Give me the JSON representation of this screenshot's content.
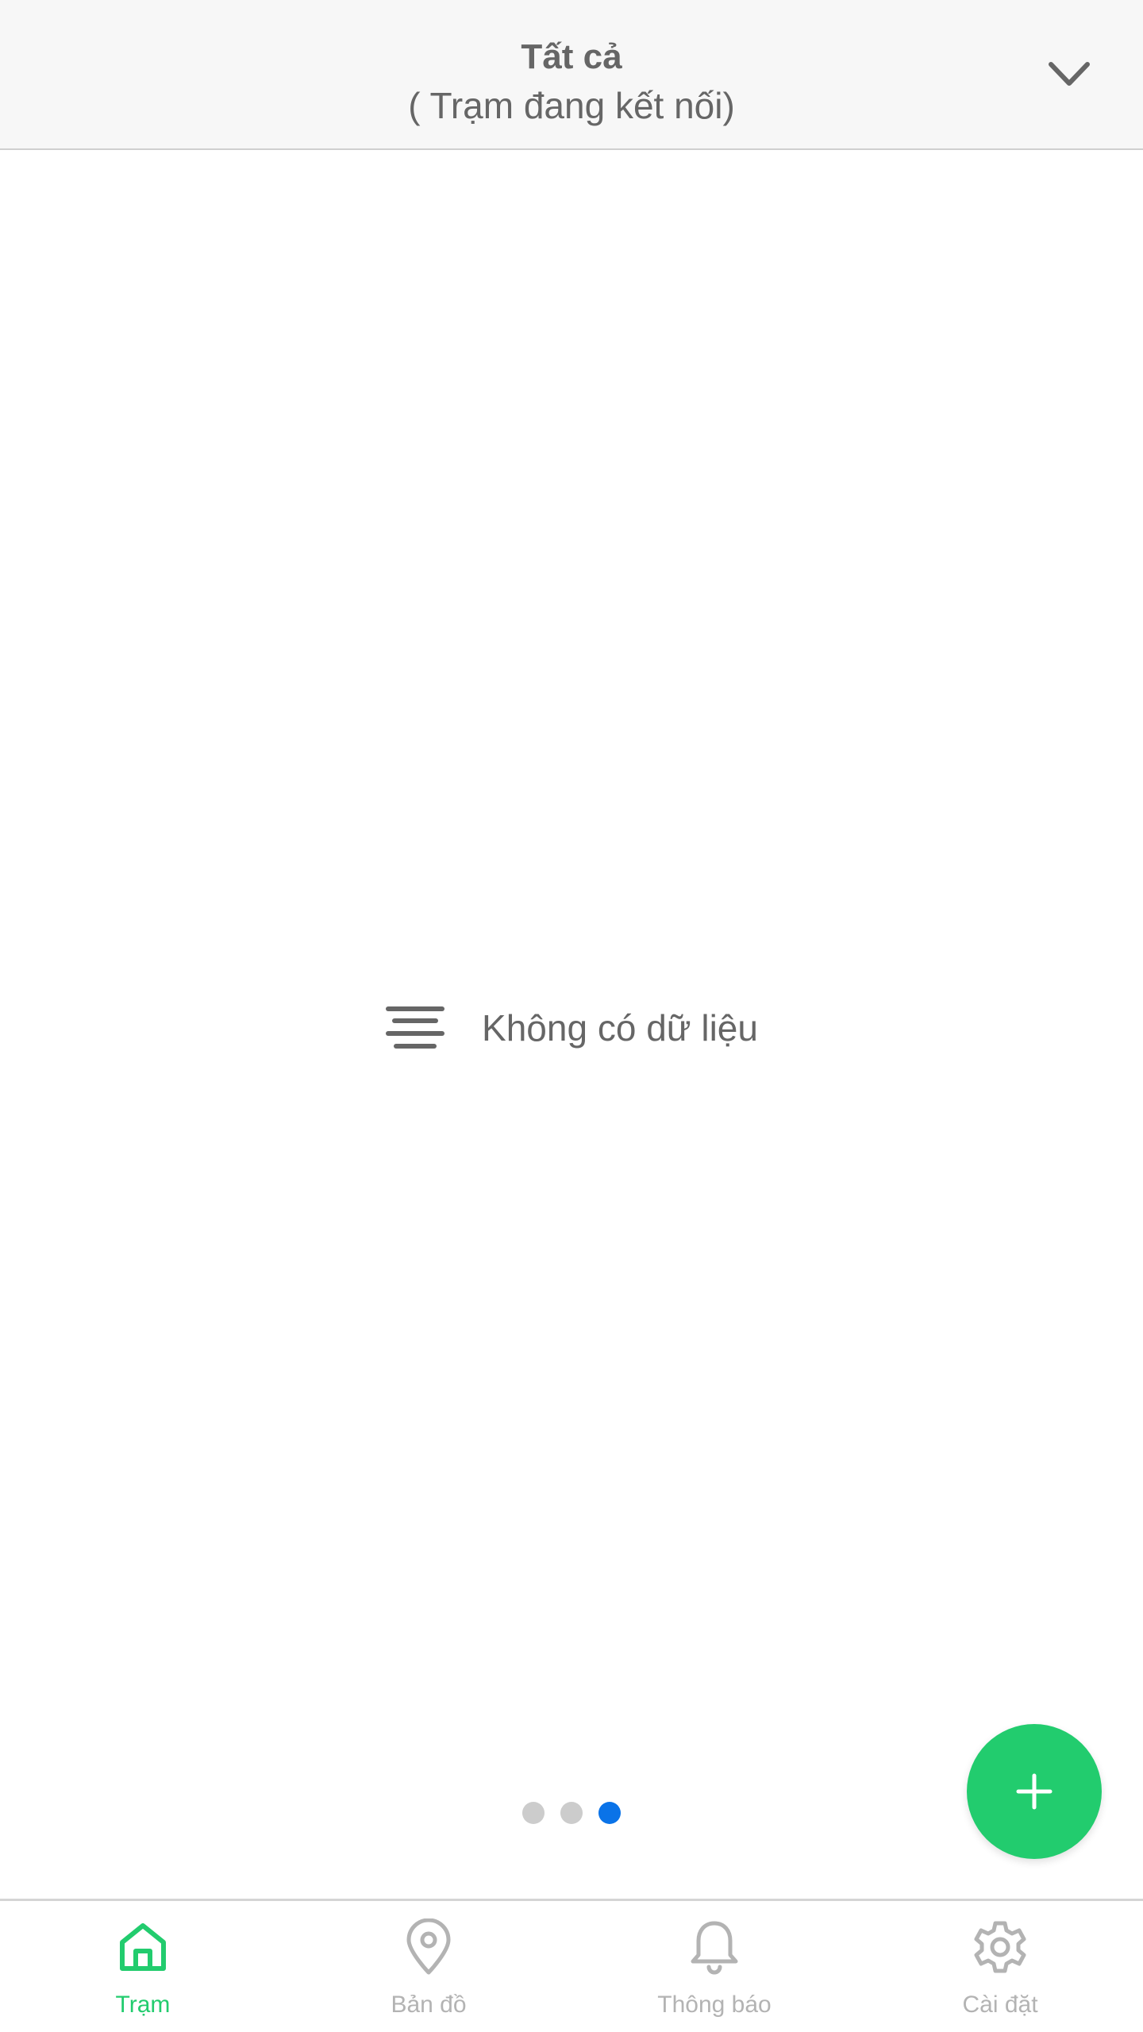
{
  "header": {
    "title": "Tất cả",
    "subtitle": "( Trạm đang kết nối)",
    "dropdown_icon": "chevron-down-icon"
  },
  "empty_state": {
    "icon": "lines-icon",
    "text": "Không có dữ liệu"
  },
  "pagination": {
    "total": 3,
    "active_index": 2
  },
  "fab": {
    "icon": "plus-icon"
  },
  "bottom_nav": {
    "items": [
      {
        "label": "Trạm",
        "icon": "home-icon",
        "active": true
      },
      {
        "label": "Bản đồ",
        "icon": "map-pin-icon",
        "active": false
      },
      {
        "label": "Thông báo",
        "icon": "bell-icon",
        "active": false
      },
      {
        "label": "Cài đặt",
        "icon": "gear-icon",
        "active": false
      }
    ]
  },
  "colors": {
    "accent": "#22cc6e",
    "active_dot": "#0a73e8",
    "inactive": "#b3b3b3",
    "text": "#666666",
    "header_bg": "#f7f7f7"
  }
}
